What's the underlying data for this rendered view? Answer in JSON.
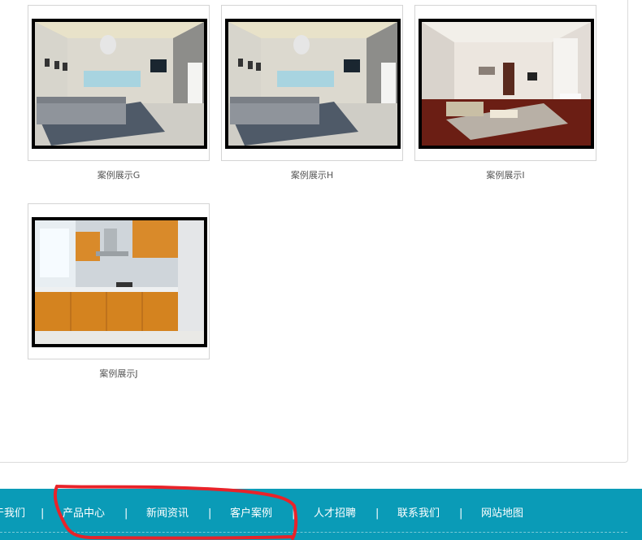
{
  "cases": [
    {
      "label": "案例展示G",
      "scene": "living-room"
    },
    {
      "label": "案例展示H",
      "scene": "living-room"
    },
    {
      "label": "案例展示I",
      "scene": "living-room-warm"
    },
    {
      "label": "案例展示J",
      "scene": "kitchen"
    }
  ],
  "footer": {
    "links": [
      "于我们",
      "产品中心",
      "新闻资讯",
      "客户案例",
      "人才招聘",
      "联系我们",
      "网站地图"
    ],
    "separator": "|"
  },
  "colors": {
    "footer_bg": "#0a9bb7",
    "annotation": "#e8232a"
  }
}
